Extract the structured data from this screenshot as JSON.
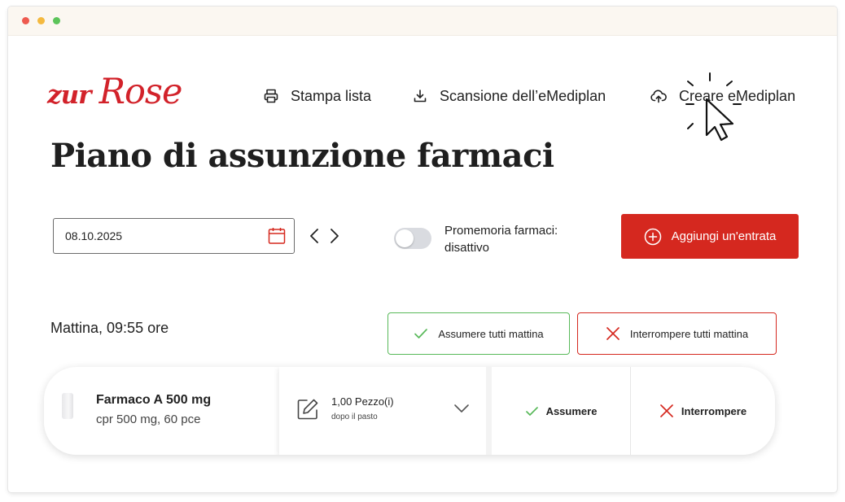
{
  "brand": {
    "logo_small": "zur",
    "logo_big": "Rose",
    "accent": "#d5281f"
  },
  "nav": {
    "print_label": "Stampa lista",
    "scan_label": "Scansione dell’eMediplan",
    "create_label": "Creare eMediplan"
  },
  "page": {
    "title": "Piano di assunzione farmaci"
  },
  "controls": {
    "date_value": "08.10.2025",
    "reminder_label": "Promemoria farmaci: disattivo",
    "reminder_on": false,
    "add_entry_label": "Aggiungi un'entrata"
  },
  "section": {
    "label": "Mattina, 09:55 ore",
    "take_all_label": "Assumere tutti mattina",
    "stop_all_label": "Interrompere tutti mattina"
  },
  "medication": {
    "name": "Farmaco A 500 mg",
    "description": "cpr 500 mg, 60 pce",
    "dose_amount": "1,00 Pezzo(i)",
    "dose_note": "dopo il pasto",
    "take_label": "Assumere",
    "stop_label": "Interrompere"
  },
  "icons": {
    "print": "printer-icon",
    "scan": "download-icon",
    "create": "cloud-upload-icon",
    "calendar": "calendar-icon",
    "prev": "chevron-left-icon",
    "next": "chevron-right-icon",
    "add": "plus-circle-icon",
    "check": "check-icon",
    "cross": "close-icon",
    "edit": "edit-icon",
    "expand": "chevron-down-icon",
    "cursor": "mouse-pointer-icon"
  }
}
